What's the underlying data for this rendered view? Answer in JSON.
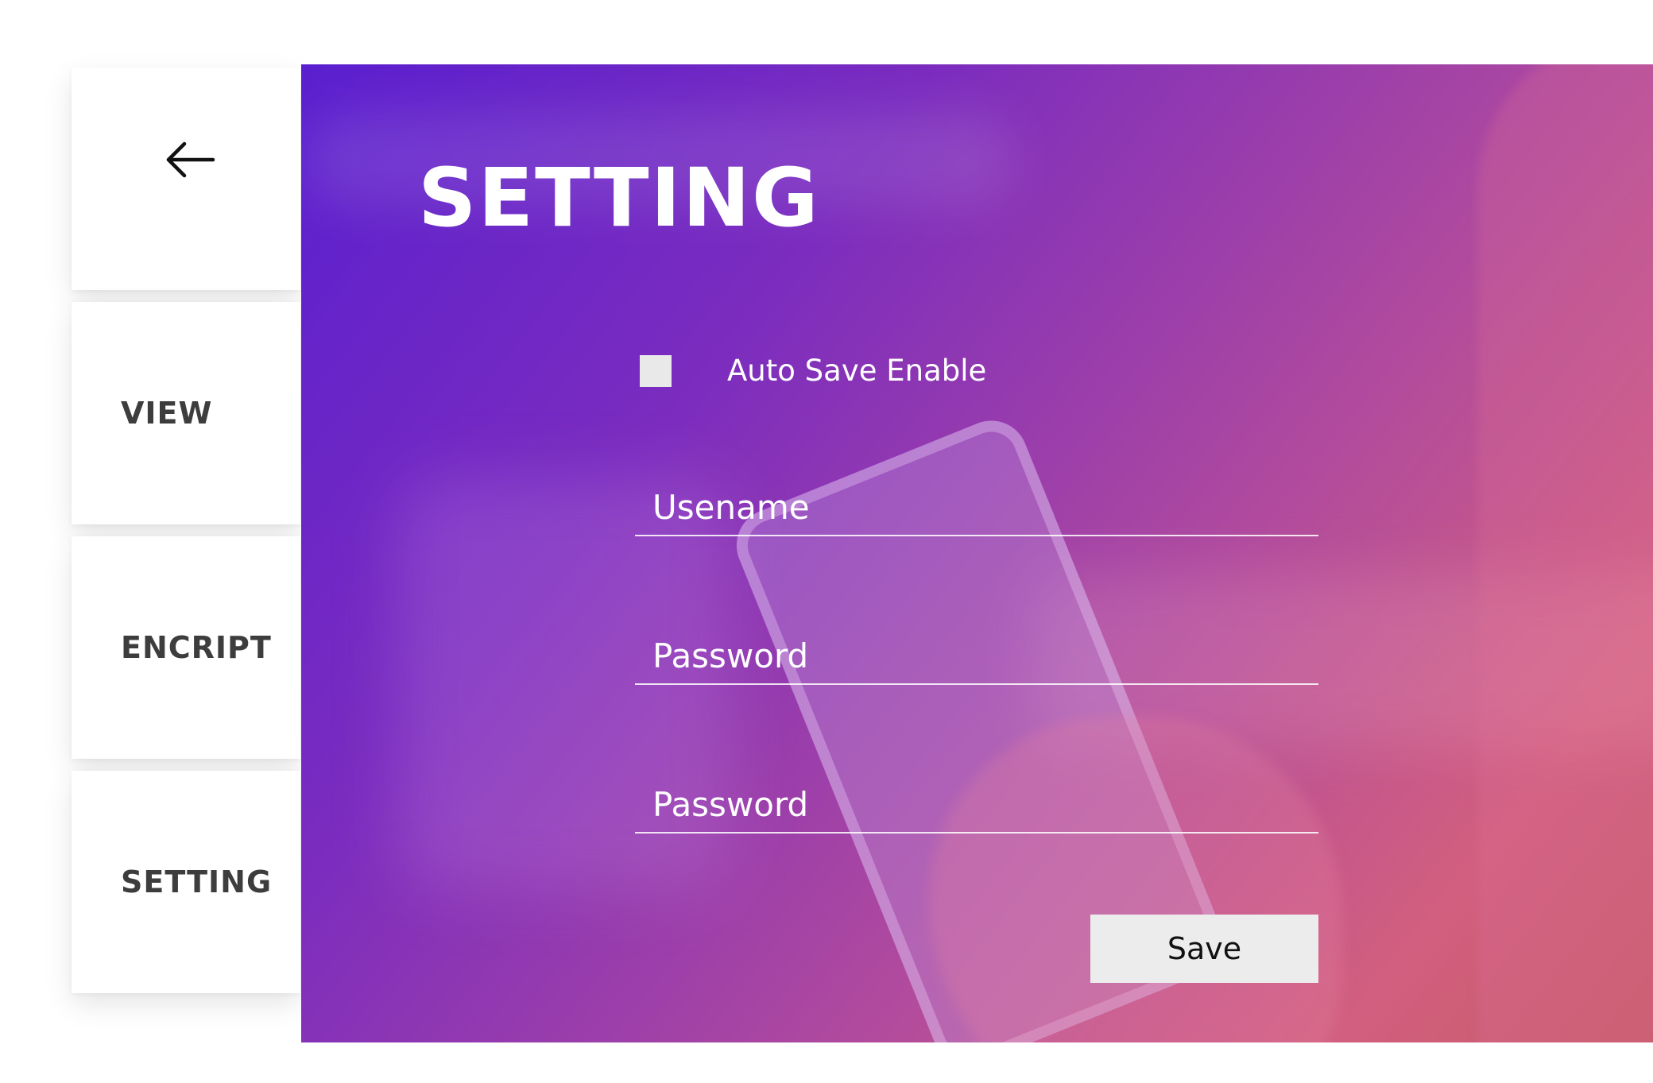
{
  "nav": {
    "back_icon": "arrow-left-icon",
    "items": [
      {
        "label": "VIEW"
      },
      {
        "label": "ENCRIPT"
      },
      {
        "label": "SETTING"
      }
    ]
  },
  "main": {
    "title": "SETTING",
    "auto_save": {
      "label": "Auto Save Enable",
      "checked": false
    },
    "fields": [
      {
        "placeholder": "Usename"
      },
      {
        "placeholder": "Password"
      },
      {
        "placeholder": "Password"
      }
    ],
    "save_label": "Save"
  },
  "colors": {
    "gradient_start": "#5a1fcf",
    "gradient_end": "#c75a66",
    "nav_text": "#3d3d3d",
    "button_bg": "#ececec"
  }
}
